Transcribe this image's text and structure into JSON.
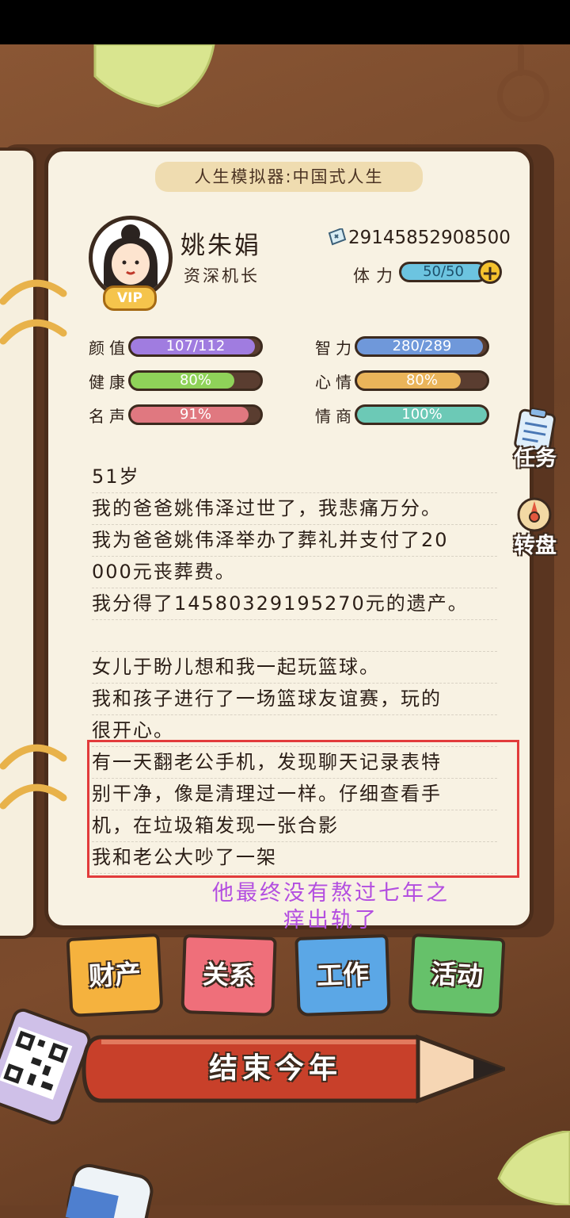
{
  "header": {
    "title": "人生模拟器:中国式人生"
  },
  "profile": {
    "name": "姚朱娟",
    "job": "资深机长",
    "vip": "VIP",
    "money": "29145852908500",
    "stamina_label": "体力",
    "stamina": "50/50",
    "stamina_fraction": 1.0
  },
  "stats": [
    {
      "label": "颜值",
      "text": "107/112",
      "fraction": 0.955,
      "color": "#a07ce0"
    },
    {
      "label": "智力",
      "text": "280/289",
      "fraction": 0.969,
      "color": "#6f98da"
    },
    {
      "label": "健康",
      "text": "80%",
      "fraction": 0.8,
      "color": "#8fd259"
    },
    {
      "label": "心情",
      "text": "80%",
      "fraction": 0.8,
      "color": "#eab45a"
    },
    {
      "label": "名声",
      "text": "91%",
      "fraction": 0.91,
      "color": "#e07880"
    },
    {
      "label": "情商",
      "text": "100%",
      "fraction": 1.0,
      "color": "#6cc9b6"
    }
  ],
  "log": [
    "51岁",
    "我的爸爸姚伟泽过世了，我悲痛万分。",
    "我为爸爸姚伟泽举办了葬礼并支付了20",
    "000元丧葬费。",
    "我分得了14580329195270元的遗产。",
    "",
    "女儿于盼儿想和我一起玩篮球。",
    "我和孩子进行了一场篮球友谊赛，玩的",
    "很开心。",
    "有一天翻老公手机，发现聊天记录表特",
    "别干净，像是清理过一样。仔细查看手",
    "机，在垃圾箱发现一张合影",
    "我和老公大吵了一架"
  ],
  "annotation": {
    "line1": "他最终没有熬过七年之",
    "line2": "痒出轨了"
  },
  "side": {
    "tasks": "任务",
    "wheel": "转盘"
  },
  "tabs": {
    "assets": "财产",
    "relations": "关系",
    "work": "工作",
    "activity": "活动"
  },
  "end_year": "结束今年",
  "colors": {
    "stamina": "#6cc4e0",
    "highlight": "#e23b3b",
    "annotation": "#b34ee0"
  }
}
